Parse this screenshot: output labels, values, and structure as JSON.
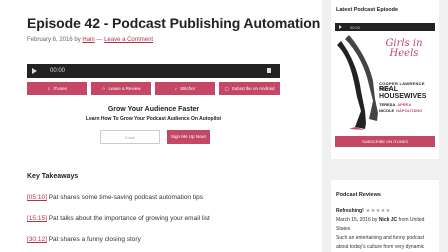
{
  "post": {
    "title": "Episode 42 - Podcast Publishing Automation",
    "date_by": "February 6, 2016 by",
    "author": "Hani",
    "separator": "—",
    "comment_link": "Leave a Comment"
  },
  "player": {
    "time": "00:00"
  },
  "buttons": [
    {
      "icon": "♫",
      "label": "iTunes"
    },
    {
      "icon": "☆",
      "label": "Leave a Review"
    },
    {
      "icon": "♪",
      "label": "Stitcher"
    },
    {
      "icon": "▢",
      "label": "Subscribe on Android"
    }
  ],
  "optin": {
    "title": "Grow Your Audience Faster",
    "subtitle": "Learn How To Grow Your Podcast Audience On Autopilot",
    "email_placeholder": "Email",
    "signup_label": "Sign Me Up Now!"
  },
  "takeaways": {
    "heading": "Key Takeaways",
    "items": [
      {
        "time": "[05:10]",
        "text": " Pat shares some time-saving podcast automation tips"
      },
      {
        "time": "[15:15]",
        "text": " Pat talks about the importance of growing your email list"
      },
      {
        "time": "[30:12]",
        "text": " Pat shares a funny closing story"
      }
    ]
  },
  "sidebar": {
    "latest_title": "Latest Podcast Episode",
    "mini_player_time": "00:00",
    "artwork": {
      "brand": "Girls in Heels",
      "line1": "COOPER LAWRENCE",
      "line1b": "WITH",
      "line2": "REAL",
      "line3": "HOUSEWIVES",
      "line4": "TERESA",
      "line4b": "APREA",
      "line5": "NICOLE",
      "line5b": "NAPOLITANO"
    },
    "subscribe_label": "SUBSCRIBE ON ITUNES",
    "reviews_title": "Podcast Reviews",
    "review": {
      "headline": "Refreshing!",
      "stars": "★★★★★",
      "date_by": "March 15, 2016 by",
      "reviewer": "Nick JC",
      "from": "from United",
      "from2": "States",
      "body1": "Such an entertaining and funny podcast",
      "body2": "about today's culture from very dynamic"
    }
  }
}
